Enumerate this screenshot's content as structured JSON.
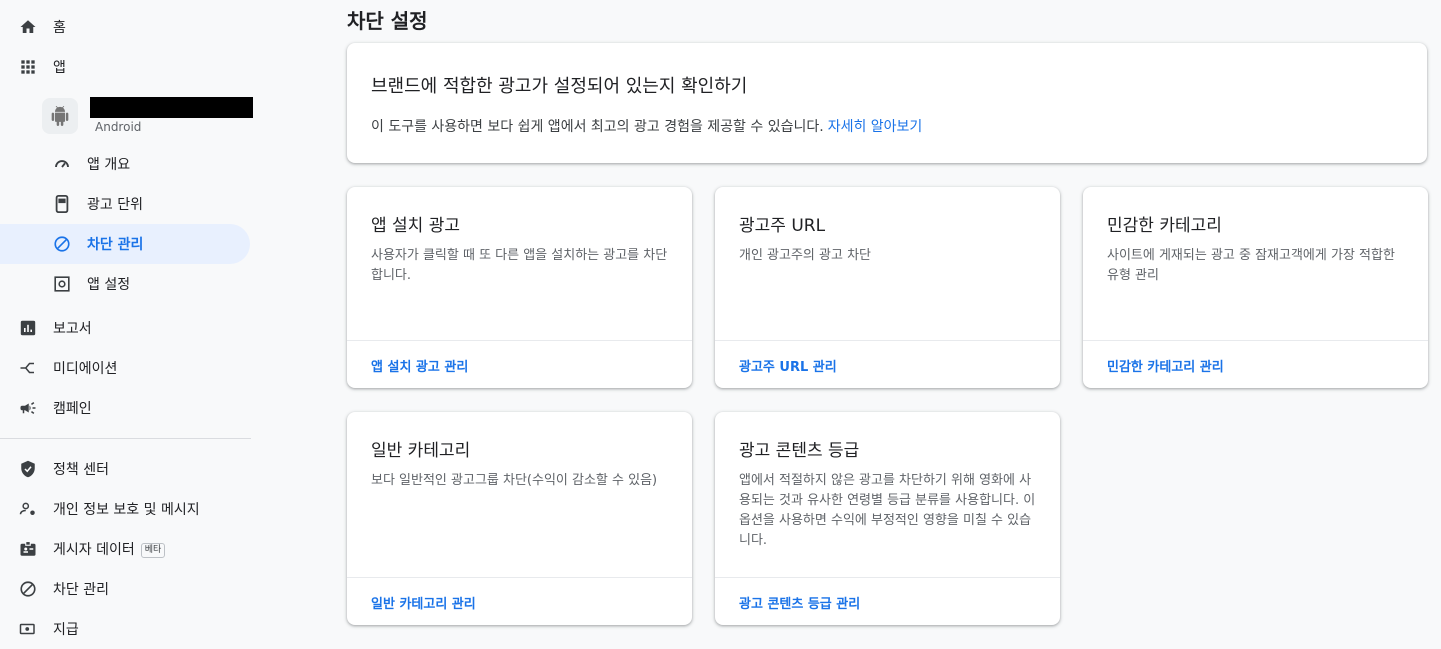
{
  "sidebar": {
    "home": "홈",
    "apps": "앱",
    "app": {
      "platform": "Android"
    },
    "sub": {
      "overview": "앱 개요",
      "ad_units": "광고 단위",
      "blocking": "차단 관리",
      "settings": "앱 설정"
    },
    "reports": "보고서",
    "mediation": "미디에이션",
    "campaigns": "캠페인",
    "policy_center": "정책 센터",
    "privacy": "개인 정보 보호 및 메시지",
    "publisher_data": "게시자 데이터",
    "beta_badge": "베타",
    "blocking_controls": "차단 관리",
    "payments": "지급"
  },
  "main": {
    "title": "차단 설정",
    "banner": {
      "title": "브랜드에 적합한 광고가 설정되어 있는지 확인하기",
      "desc": "이 도구를 사용하면 보다 쉽게 앱에서 최고의 광고 경험을 제공할 수 있습니다.",
      "link": "자세히 알아보기"
    },
    "cards": [
      {
        "title": "앱 설치 광고",
        "desc": "사용자가 클릭할 때 또 다른 앱을 설치하는 광고를 차단합니다.",
        "link": "앱 설치 광고 관리"
      },
      {
        "title": "광고주 URL",
        "desc": "개인 광고주의 광고 차단",
        "link": "광고주 URL 관리"
      },
      {
        "title": "민감한 카테고리",
        "desc": "사이트에 게재되는 광고 중 잠재고객에게 가장 적합한 유형 관리",
        "link": "민감한 카테고리 관리"
      },
      {
        "title": "일반 카테고리",
        "desc": "보다 일반적인 광고그룹 차단(수익이 감소할 수 있음)",
        "link": "일반 카테고리 관리"
      },
      {
        "title": "광고 콘텐츠 등급",
        "desc": "앱에서 적절하지 않은 광고를 차단하기 위해 영화에 사용되는 것과 유사한 연령별 등급 분류를 사용합니다. 이 옵션을 사용하면 수익에 부정적인 영향을 미칠 수 있습니다.",
        "link": "광고 콘텐츠 등급 관리"
      }
    ]
  },
  "colors": {
    "accent": "#1a73e8",
    "active_bg": "#e8f0fe"
  }
}
